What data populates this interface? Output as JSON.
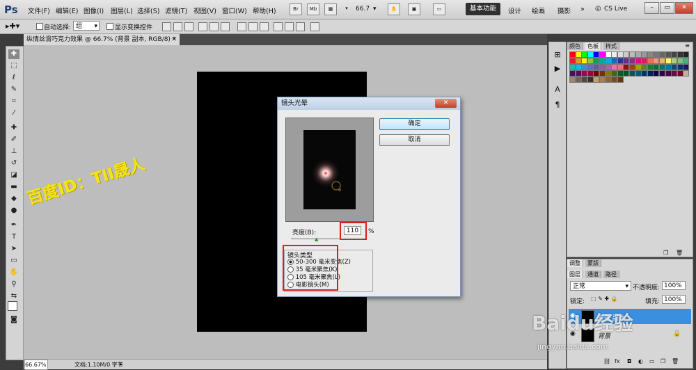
{
  "app": {
    "logo": "Ps"
  },
  "menu": [
    "文件(F)",
    "编辑(E)",
    "图像(I)",
    "图层(L)",
    "选择(S)",
    "滤镜(T)",
    "视图(V)",
    "窗口(W)",
    "帮助(H)"
  ],
  "toolbar_top": {
    "zoom": "66.7"
  },
  "workspaces": {
    "active": "基本功能",
    "items": [
      "设计",
      "绘画",
      "摄影"
    ],
    "cslive": "CS Live"
  },
  "options": {
    "auto_select": "自动选择:",
    "auto_select_value": "组",
    "show_transform": "显示变换控件"
  },
  "document": {
    "tab_title": "纵情丝滑巧克力效果 @ 66.7% (背景 副本, RGB/8) *"
  },
  "watermark": {
    "text": "百度ID：TII晟人"
  },
  "status": {
    "zoom": "66.67%",
    "doc": "文档:1.10M/0 字节"
  },
  "swatch_panel": {
    "tabs": [
      "颜色",
      "色板",
      "样式"
    ],
    "active_tab": "色板"
  },
  "layers_panel": {
    "top_tabs": [
      "调整",
      "蒙版"
    ],
    "tabs": [
      "图层",
      "通道",
      "路径"
    ],
    "blend_mode": "正常",
    "opacity_label": "不透明度:",
    "opacity": "100%",
    "lock_label": "锁定:",
    "fill_label": "填充:",
    "fill": "100%",
    "layers": [
      {
        "name": "背景 副本"
      },
      {
        "name": "背景"
      }
    ]
  },
  "dialog": {
    "title": "镜头光晕",
    "close": "✕",
    "ok": "确定",
    "cancel": "取消",
    "brightness_label": "亮度(B):",
    "brightness_value": "110",
    "percent": "%",
    "lens_type_label": "镜头类型",
    "lens_options": [
      "50-300 毫米变焦(Z)",
      "35 毫米聚焦(K)",
      "105 毫米聚焦(L)",
      "电影镜头(M)"
    ],
    "selected_lens": 0
  },
  "baidu": {
    "logo": "Baidu经验",
    "url": "jingyan.baidu.com"
  },
  "colors": {
    "accent_red": "#d61e1e",
    "selected_layer": "#3b8fe0",
    "watermark": "#f4e512"
  }
}
